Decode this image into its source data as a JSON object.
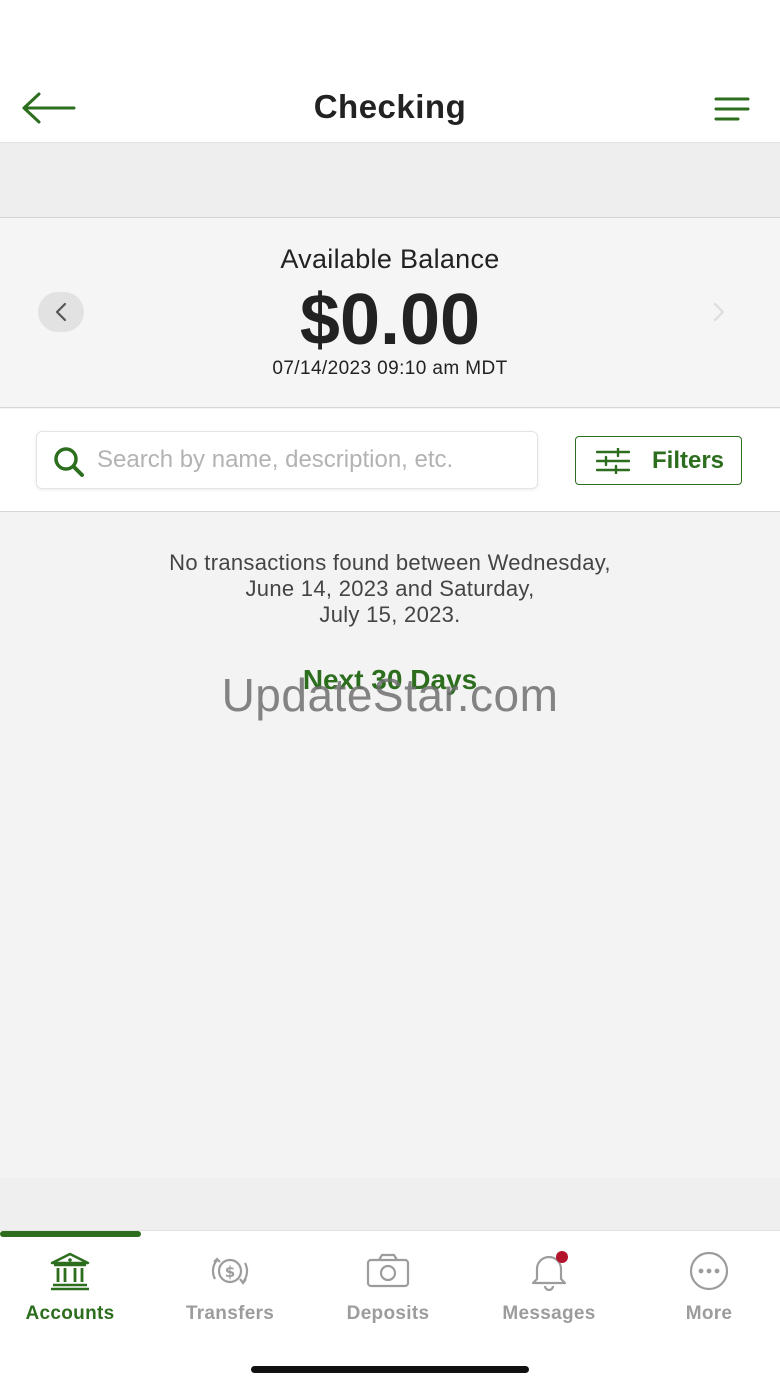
{
  "header": {
    "title": "Checking",
    "back_icon": "arrow-left-icon",
    "menu_icon": "menu-lines-icon"
  },
  "balance": {
    "label": "Available Balance",
    "amount": "$0.00",
    "timestamp": "07/14/2023 09:10 am MDT"
  },
  "search": {
    "placeholder": "Search by name, description, etc.",
    "value": ""
  },
  "filters": {
    "label": "Filters"
  },
  "transactions": {
    "empty_line1": "No transactions found between Wednesday,",
    "empty_line2": "June 14, 2023 and Saturday,",
    "empty_line3": "July 15, 2023.",
    "next_link": "Next 30 Days"
  },
  "watermark": "UpdateStar.com",
  "tabs": [
    {
      "label": "Accounts",
      "icon": "bank-icon",
      "active": true
    },
    {
      "label": "Transfers",
      "icon": "money-transfer-icon",
      "active": false
    },
    {
      "label": "Deposits",
      "icon": "camera-icon",
      "active": false
    },
    {
      "label": "Messages",
      "icon": "bell-icon",
      "active": false,
      "badge": true
    },
    {
      "label": "More",
      "icon": "more-dots-icon",
      "active": false
    }
  ],
  "colors": {
    "accent": "#2d6e1e",
    "badge": "#b3142b",
    "inactive": "#9c9c9c"
  }
}
